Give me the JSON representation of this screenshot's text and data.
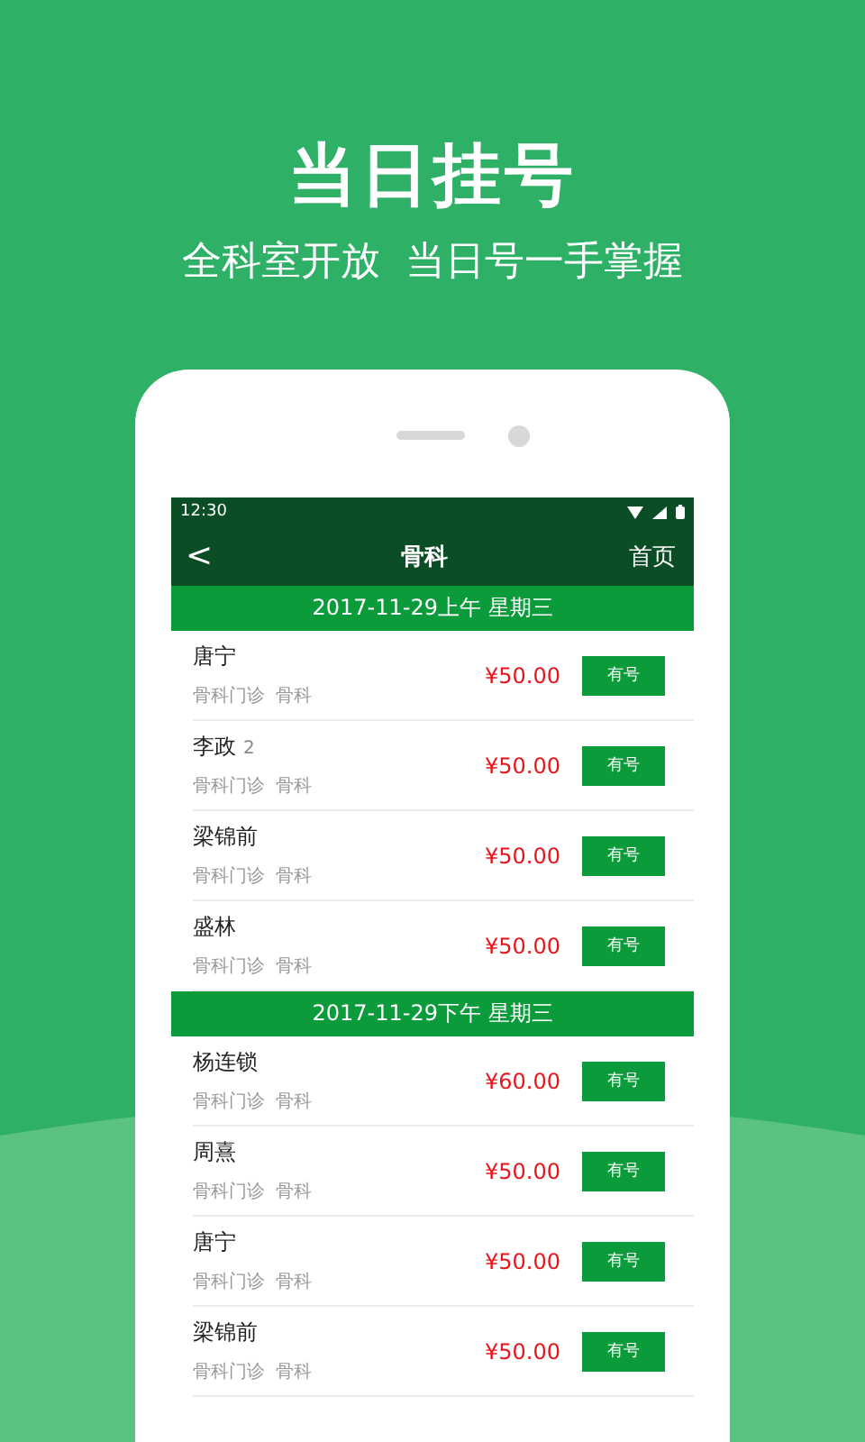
{
  "headline": "当日挂号",
  "tagline": "全科室开放  当日号一手掌握",
  "status_bar": {
    "time": "12:30"
  },
  "nav": {
    "back": "<",
    "title": "骨科",
    "home": "首页"
  },
  "sections": [
    {
      "title": "2017-11-29上午 星期三",
      "rows": [
        {
          "name": "唐宁",
          "dept": "骨科门诊",
          "specialty": "骨科",
          "price": "¥50.00",
          "action": "有号"
        },
        {
          "name": "李政",
          "note": "2",
          "dept": "骨科门诊",
          "specialty": "骨科",
          "price": "¥50.00",
          "action": "有号"
        },
        {
          "name": "梁锦前",
          "dept": "骨科门诊",
          "specialty": "骨科",
          "price": "¥50.00",
          "action": "有号"
        },
        {
          "name": "盛林",
          "dept": "骨科门诊",
          "specialty": "骨科",
          "price": "¥50.00",
          "action": "有号"
        }
      ]
    },
    {
      "title": "2017-11-29下午 星期三",
      "rows": [
        {
          "name": "杨连锁",
          "dept": "骨科门诊",
          "specialty": "骨科",
          "price": "¥60.00",
          "action": "有号"
        },
        {
          "name": "周熹",
          "dept": "骨科门诊",
          "specialty": "骨科",
          "price": "¥50.00",
          "action": "有号"
        },
        {
          "name": "唐宁",
          "dept": "骨科门诊",
          "specialty": "骨科",
          "price": "¥50.00",
          "action": "有号"
        },
        {
          "name": "梁锦前",
          "dept": "骨科门诊",
          "specialty": "骨科",
          "price": "¥50.00",
          "action": "有号"
        }
      ]
    }
  ]
}
